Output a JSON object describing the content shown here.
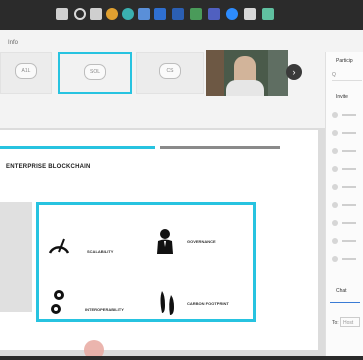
{
  "taskbar": {
    "icons": [
      "windows-icon",
      "search-icon",
      "task-view-icon",
      "chrome-icon",
      "edge-icon",
      "store-icon",
      "mail-icon",
      "word-icon",
      "excel-icon",
      "teams-icon",
      "zoom-icon",
      "vlc-icon"
    ]
  },
  "header": {
    "tag": "Info"
  },
  "participants": [
    {
      "initials": "A1L",
      "name": ""
    },
    {
      "initials": "SOL",
      "name": ""
    },
    {
      "initials": "CS",
      "name": ""
    }
  ],
  "slide": {
    "title": "ENTERPRISE BLOCKCHAIN",
    "features": [
      {
        "label": "SCALABILITY",
        "icon": "gauge-icon"
      },
      {
        "label": "GOVERNANCE",
        "icon": "manager-icon"
      },
      {
        "label": "INTEROPERABILITY",
        "icon": "gears-icon"
      },
      {
        "label": "CARBON FOOTPRINT",
        "icon": "footprint-icon"
      }
    ]
  },
  "sidebar": {
    "title": "Particip",
    "search_placeholder": "Q",
    "sub": "Invite",
    "chat_title": "Chat",
    "to_label": "To:",
    "input_placeholder": "Host"
  }
}
